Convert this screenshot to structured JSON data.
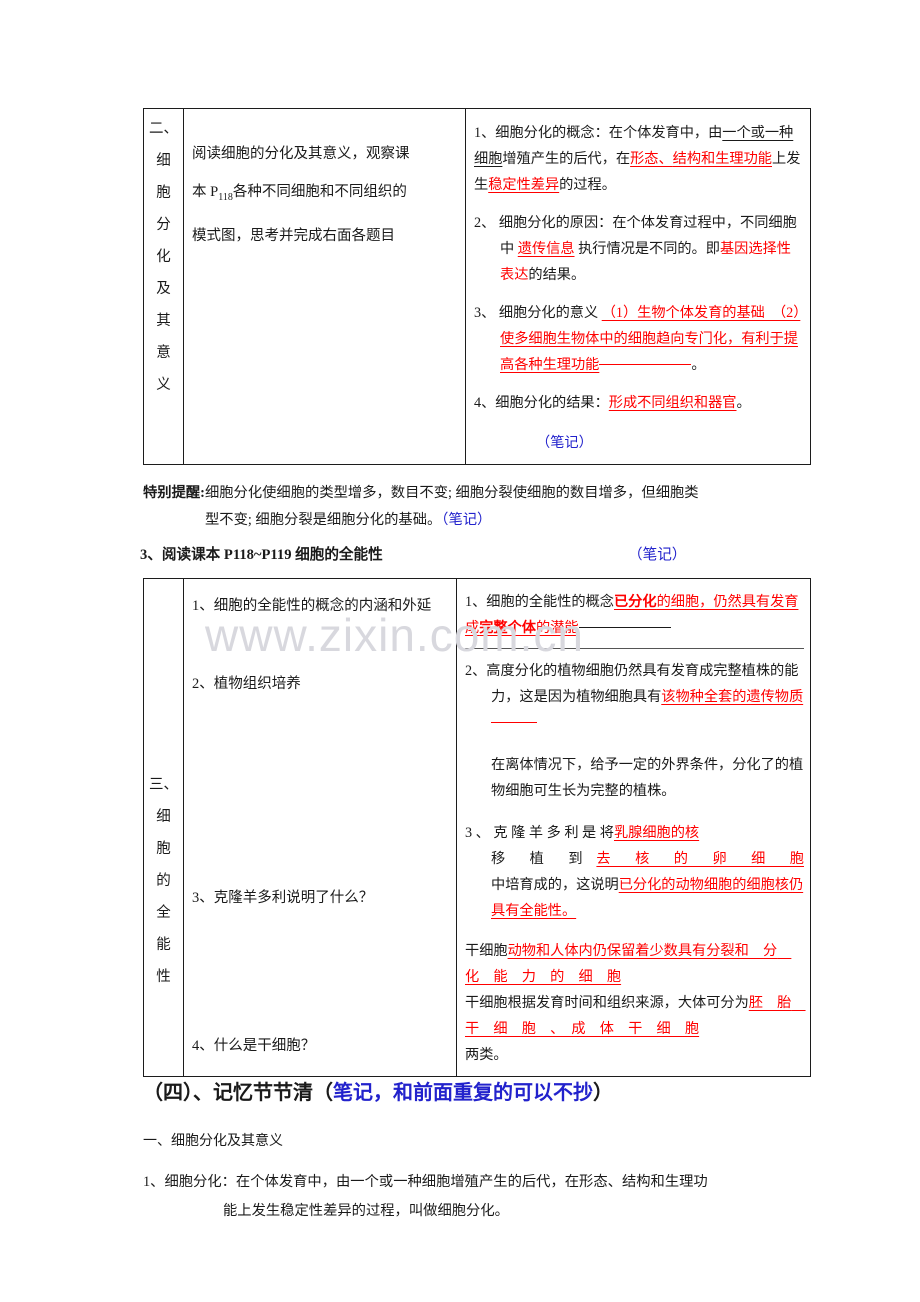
{
  "watermark": {
    "text": "www.zixin.com.cn"
  },
  "table1": {
    "label": "二、细胞分化及其意义",
    "label_chars": [
      "二、",
      "细",
      "胞",
      "分",
      "化",
      "及",
      "其",
      "意",
      "义"
    ],
    "question": {
      "line1": "阅读细胞的分化及其意义，观察课",
      "line2_a": "本 P",
      "line2_sub": "118",
      "line2_b": "各种不同细胞和不同组织的",
      "line3": "模式图，思考并完成右面各题目"
    },
    "answers": {
      "item1_prefix": "1、细胞分化的概念：在个体发育中，由",
      "item1_blank1": "一个或一种细胞",
      "item1_mid": "增殖产生的后代，在",
      "item1_blank2": "形态、",
      "item1_blank3": "结构和生理功能",
      "item1_mid2": "上发生",
      "item1_blank4": "稳定性差异",
      "item1_suffix": "的过程。",
      "item2_prefix": "2、 细胞分化的原因：在个体发育过程中，不同细胞中",
      "item2_blank1": "遗传信息",
      "item2_mid": "执行情况是不同的。即",
      "item2_blank2": "基因选择性表达",
      "item2_suffix": "的结果。",
      "item3_prefix": "3、 细胞分化的意义",
      "item3_blank": "（1）生物个体发育的基础　（2）使多细胞生物体中的细胞趋向专门化，有利于提高各种生理功能",
      "item3_suffix": "。",
      "item4_prefix": "4、细胞分化的结果：",
      "item4_blank": "形成不同组织和器官",
      "item4_suffix": "。",
      "note": "（笔记）"
    }
  },
  "special_tip": {
    "label": "特别提醒:",
    "line1": "细胞分化使细胞的类型增多，数目不变; 细胞分裂使细胞的数目增多，但细胞类",
    "line2": "型不变; 细胞分裂是细胞分化的基础。",
    "note": "（笔记）"
  },
  "read_heading": {
    "text": "3、阅读课本 P118~P119 细胞的全能性",
    "note": "（笔记）"
  },
  "table2": {
    "label": "三、细胞的全能性",
    "label_chars": [
      "三、",
      "细",
      "胞",
      "的",
      "全",
      "能",
      "性"
    ],
    "questions": {
      "q1": "1、细胞的全能性的概念的内涵和外延",
      "q2": "2、植物组织培养",
      "q3": "3、克隆羊多利说明了什么？",
      "q4": "4、什么是干细胞？"
    },
    "answers": {
      "a1_prefix": "1、细胞的全能性的概念",
      "a1_blank_a": "已分化",
      "a1_blank_b": "的细胞，仍然具有发育成",
      "a1_blank_c": "完整个体",
      "a1_blank_d": "的潜能",
      "a2_text": "2、高度分化的植物细胞仍然具有发育成完整植株的能力，这是因为植物细胞具有",
      "a2_blank": "该物种全套的遗传物质",
      "a2_extra": "在离体情况下，给予一定的外界条件，分化了的植物细胞可生长为完整的植株。",
      "a3_prefix": "3 、 克 隆 羊 多 利 是 将",
      "a3_blank1": "乳腺细胞的核",
      "a3_mid1": "移　植　到",
      "a3_blank2": "去　核　的　卵　细　胞",
      "a3_mid2": "中培育成的，这说明",
      "a3_blank3": "已分化的动物细胞的细胞核仍具有全能性",
      "a3_suffix": "。",
      "a4_prefix": "干细胞",
      "a4_blank1": "动物和人体内仍保留着少数具有分裂和　分　化　能　力　的　细　胞",
      "a4_mid": "干细胞根据发育时间和组织来源，大体可分为",
      "a4_blank2": "胚　胎　干　细　胞　、　成　体　干　细　胞",
      "a4_suffix": "两类。"
    }
  },
  "section4": {
    "prefix": "（四）、记忆节节清（",
    "note": "笔记，和前面重复的可以不抄",
    "suffix": "）"
  },
  "sub_heading": "一、细胞分化及其意义",
  "final_item": {
    "line1": "1、细胞分化：在个体发育中，由一个或一种细胞增殖产生的后代，在形态、结构和生理功",
    "line2": "能上发生稳定性差异的过程，叫做细胞分化。"
  },
  "colors": {
    "red": "#ff0000",
    "blue": "#2222cc",
    "text": "#1a1a1a",
    "watermark": "#d8d8de"
  }
}
